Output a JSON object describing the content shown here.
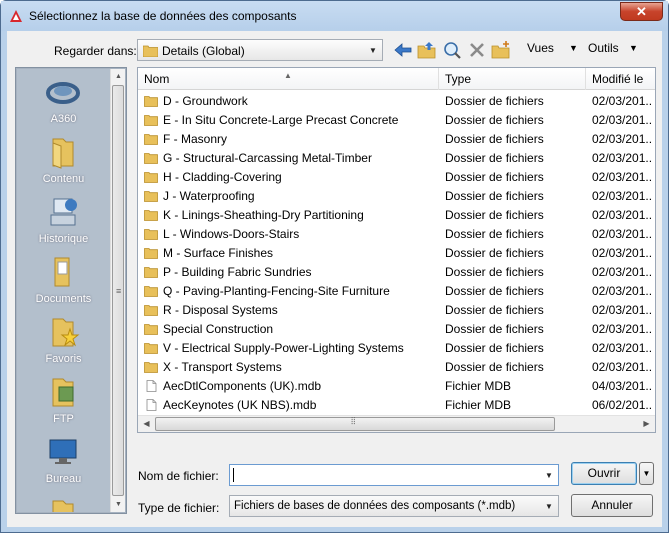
{
  "window": {
    "title": "Sélectionnez la base de données des composants",
    "close_glyph": "✕"
  },
  "toolbar": {
    "look_in_label": "Regarder dans:",
    "look_in_value": "Details (Global)",
    "views_label": "Vues",
    "tools_label": "Outils"
  },
  "places": [
    {
      "label": "A360",
      "icon": "a360-icon"
    },
    {
      "label": "Contenu",
      "icon": "folder-icon"
    },
    {
      "label": "Historique",
      "icon": "history-icon"
    },
    {
      "label": "Documents",
      "icon": "documents-icon"
    },
    {
      "label": "Favoris",
      "icon": "favorites-icon"
    },
    {
      "label": "FTP",
      "icon": "ftp-icon"
    },
    {
      "label": "Bureau",
      "icon": "desktop-icon"
    },
    {
      "label": "",
      "icon": "folder-icon"
    }
  ],
  "file_list": {
    "columns": [
      "Nom",
      "Type",
      "Modifié le"
    ],
    "rows": [
      {
        "name": "D - Groundwork",
        "type": "Dossier de fichiers",
        "date": "02/03/201...",
        "kind": "folder"
      },
      {
        "name": "E - In Situ Concrete-Large Precast Concrete",
        "type": "Dossier de fichiers",
        "date": "02/03/201...",
        "kind": "folder"
      },
      {
        "name": "F - Masonry",
        "type": "Dossier de fichiers",
        "date": "02/03/201...",
        "kind": "folder"
      },
      {
        "name": "G - Structural-Carcassing Metal-Timber",
        "type": "Dossier de fichiers",
        "date": "02/03/201...",
        "kind": "folder"
      },
      {
        "name": "H - Cladding-Covering",
        "type": "Dossier de fichiers",
        "date": "02/03/201...",
        "kind": "folder"
      },
      {
        "name": "J - Waterproofing",
        "type": "Dossier de fichiers",
        "date": "02/03/201...",
        "kind": "folder"
      },
      {
        "name": "K - Linings-Sheathing-Dry Partitioning",
        "type": "Dossier de fichiers",
        "date": "02/03/201...",
        "kind": "folder"
      },
      {
        "name": "L - Windows-Doors-Stairs",
        "type": "Dossier de fichiers",
        "date": "02/03/201...",
        "kind": "folder"
      },
      {
        "name": "M - Surface Finishes",
        "type": "Dossier de fichiers",
        "date": "02/03/201...",
        "kind": "folder"
      },
      {
        "name": "P - Building Fabric Sundries",
        "type": "Dossier de fichiers",
        "date": "02/03/201...",
        "kind": "folder"
      },
      {
        "name": "Q - Paving-Planting-Fencing-Site Furniture",
        "type": "Dossier de fichiers",
        "date": "02/03/201...",
        "kind": "folder"
      },
      {
        "name": "R - Disposal Systems",
        "type": "Dossier de fichiers",
        "date": "02/03/201...",
        "kind": "folder"
      },
      {
        "name": "Special Construction",
        "type": "Dossier de fichiers",
        "date": "02/03/201...",
        "kind": "folder"
      },
      {
        "name": "V - Electrical Supply-Power-Lighting Systems",
        "type": "Dossier de fichiers",
        "date": "02/03/201...",
        "kind": "folder"
      },
      {
        "name": "X - Transport Systems",
        "type": "Dossier de fichiers",
        "date": "02/03/201...",
        "kind": "folder"
      },
      {
        "name": "AecDtlComponents (UK).mdb",
        "type": "Fichier MDB",
        "date": "04/03/201...",
        "kind": "file"
      },
      {
        "name": "AecKeynotes (UK NBS).mdb",
        "type": "Fichier MDB",
        "date": "06/02/201...",
        "kind": "file"
      }
    ]
  },
  "form": {
    "filename_label": "Nom de fichier:",
    "filename_value": "",
    "filetype_label": "Type de fichier:",
    "filetype_value": "Fichiers de bases de données des composants (*.mdb)",
    "open_label": "Ouvrir",
    "cancel_label": "Annuler"
  },
  "colors": {
    "accent": "#3c7fb1",
    "places_bg": "#b3bfcc",
    "folder": "#e8c05a"
  }
}
